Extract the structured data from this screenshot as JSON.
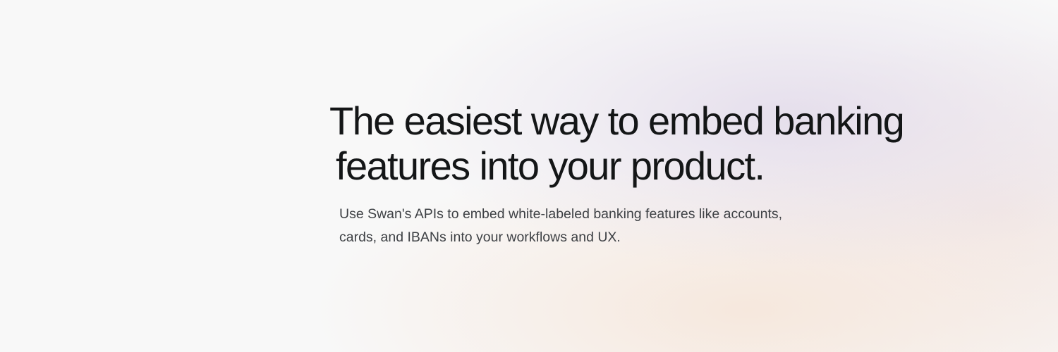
{
  "hero": {
    "headline": {
      "line1": "The easiest way to embed banking",
      "line2": "features into your product."
    },
    "subtext": {
      "line1": "Use Swan's APIs to embed white-labeled banking features like accounts,",
      "line2": "cards, and IBANs into your workflows and UX."
    }
  },
  "colors": {
    "background": "#f8f8f8",
    "headline": "#141617",
    "subtext": "#3e4145",
    "glow_lavender": "#e2daea",
    "glow_peach": "#f6e6da"
  }
}
